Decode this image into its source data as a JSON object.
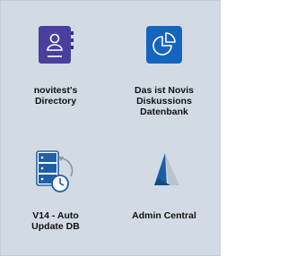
{
  "apps": [
    {
      "name": "novitest's\nDirectory",
      "icon": "directory-book-icon",
      "color": "#4a3f9e"
    },
    {
      "name": "Das ist Novis\nDiskussions\nDatenbank",
      "icon": "pie-chart-icon",
      "color": "#1565c0"
    },
    {
      "name": "V14 - Auto\nUpdate DB",
      "icon": "server-clock-icon",
      "color": "#1f5fa8"
    },
    {
      "name": "Admin Central",
      "icon": "admin-logo-icon",
      "color": "#1a5fa6"
    }
  ]
}
